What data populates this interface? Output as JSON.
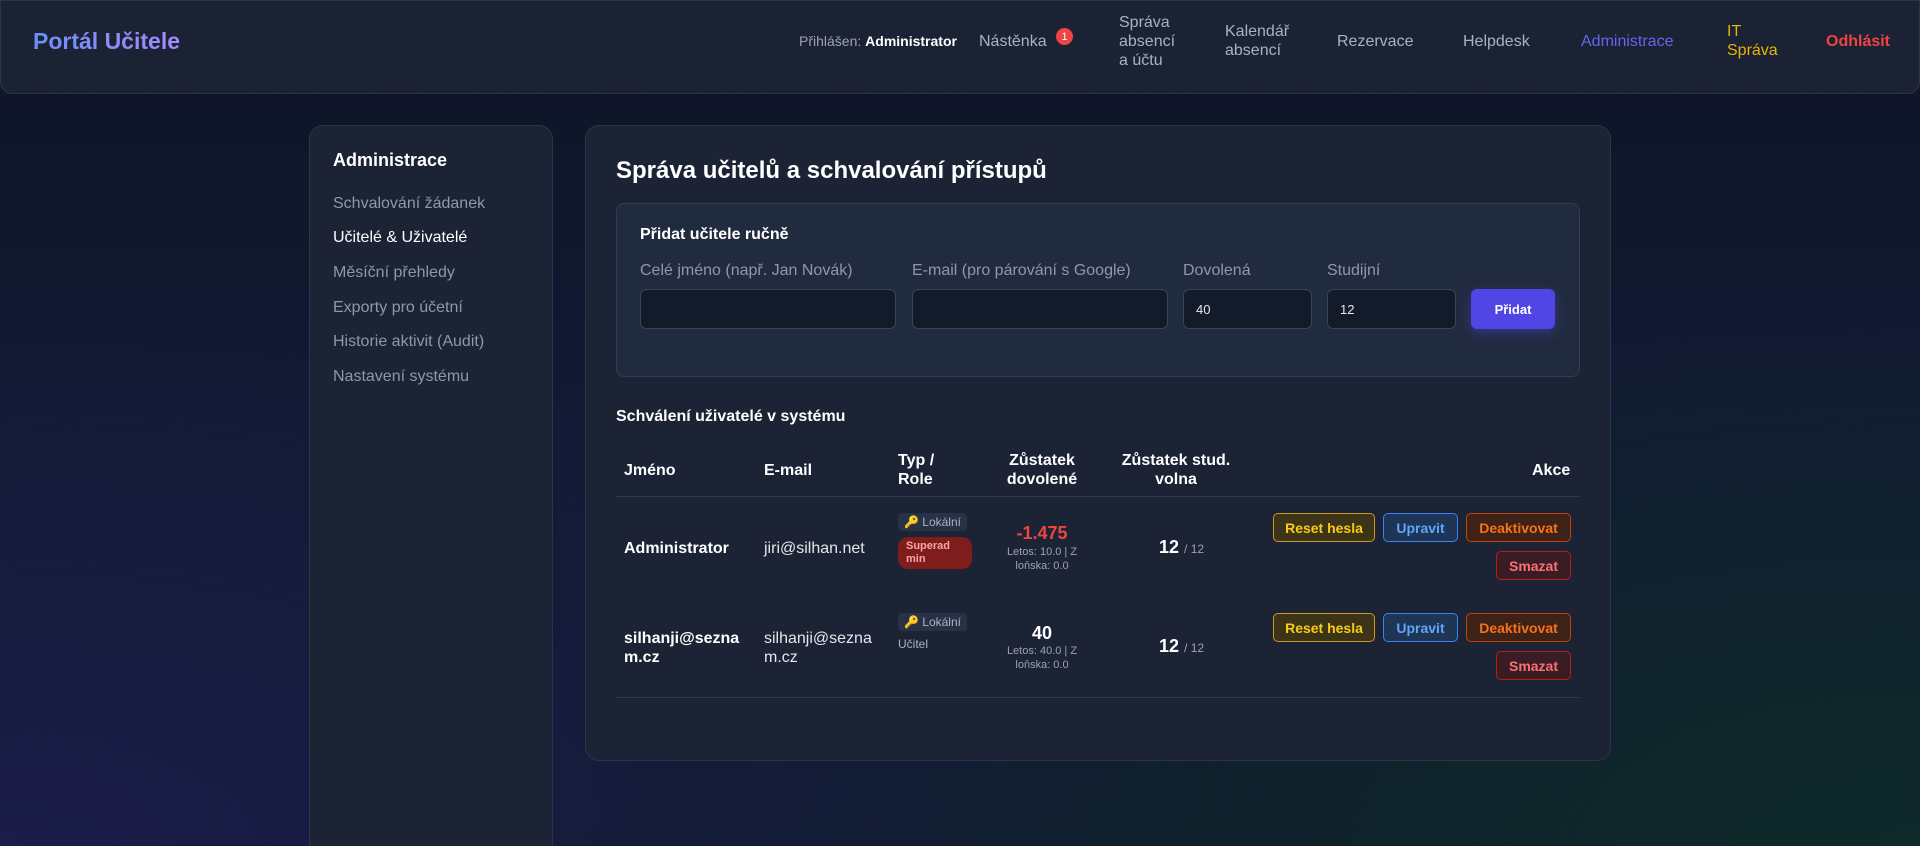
{
  "app": {
    "title": "Portál Učitele"
  },
  "nav": {
    "login_label": "Přihlášen:",
    "login_user": "Administrator",
    "dashboard": "Nástěnka",
    "dashboard_badge": "1",
    "absence_line1": "Správa",
    "absence_line2": "absencí",
    "absence_line3": "a účtu",
    "calendar_line1": "Kalendář",
    "calendar_line2": "absencí",
    "reservations": "Rezervace",
    "helpdesk": "Helpdesk",
    "admin": "Administrace",
    "it_line1": "IT",
    "it_line2": "Správa",
    "logout": "Odhlásit"
  },
  "sidebar": {
    "title": "Administrace",
    "items": [
      {
        "label": "Schvalování žádanek"
      },
      {
        "label": "Učitelé & Uživatelé"
      },
      {
        "label": "Měsíční přehledy"
      },
      {
        "label": "Exporty pro účetní"
      },
      {
        "label": "Historie aktivit (Audit)"
      },
      {
        "label": "Nastavení systému"
      }
    ]
  },
  "main": {
    "title": "Správa učitelů a schvalování přístupů",
    "add_form": {
      "title": "Přidat učitele ručně",
      "name_label": "Celé jméno (např. Jan Novák)",
      "name_value": "",
      "email_label": "E-mail (pro párování s Google)",
      "email_value": "",
      "vacation_label": "Dovolená",
      "vacation_value": "40",
      "study_label": "Studijní",
      "study_value": "12",
      "add_button": "Přidat"
    },
    "users_title": "Schválení uživatelé v systému",
    "columns": {
      "name": "Jméno",
      "email": "E-mail",
      "type_line1": "Typ /",
      "type_line2": "Role",
      "vacation_line1": "Zůstatek",
      "vacation_line2": "dovolené",
      "study_line1": "Zůstatek stud.",
      "study_line2": "volna",
      "actions": "Akce"
    },
    "rows": [
      {
        "name": "Administrator",
        "email": "jiri@silhan.net",
        "type": "🔑 Lokální",
        "role_line1": "Superad",
        "role_line2": "min",
        "vacation": "-1.475",
        "vacation_sub1": "Letos: 10.0 | Z",
        "vacation_sub2": "loňska: 0.0",
        "study": "12",
        "study_total": "/ 12",
        "btn_reset": "Reset hesla",
        "btn_edit": "Upravit",
        "btn_deactivate": "Deaktivovat",
        "btn_delete": "Smazat"
      },
      {
        "name_line1": "silhanji@sezna",
        "name_line2": "m.cz",
        "email_line1": "silhanji@sezna",
        "email_line2": "m.cz",
        "type": "🔑 Lokální",
        "role": "Učitel",
        "vacation": "40",
        "vacation_sub1": "Letos: 40.0 | Z",
        "vacation_sub2": "loňska: 0.0",
        "study": "12",
        "study_total": "/ 12",
        "btn_reset": "Reset hesla",
        "btn_edit": "Upravit",
        "btn_deactivate": "Deaktivovat",
        "btn_delete": "Smazat"
      }
    ]
  },
  "colors": {
    "accent": "#4f46e5",
    "negative": "#ef4444",
    "admin_nav": "#6366f1",
    "it_nav": "#eab308"
  }
}
